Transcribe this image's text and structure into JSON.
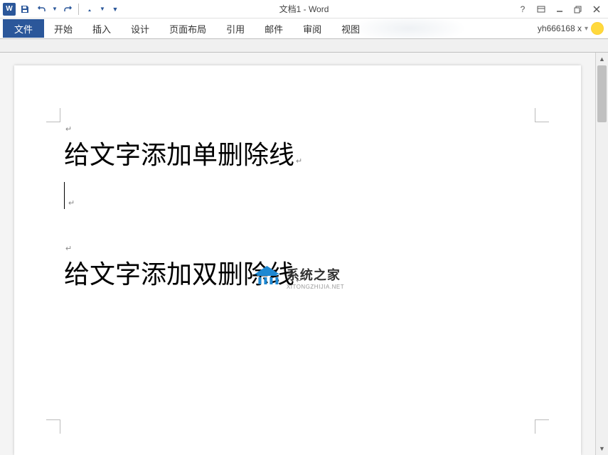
{
  "window": {
    "title": "文档1 - Word",
    "user": "yh666168 x"
  },
  "qat": {
    "save_tooltip": "保存",
    "undo_tooltip": "撤销",
    "redo_tooltip": "重做",
    "touch_tooltip": "触摸/鼠标模式"
  },
  "tabs": {
    "file": "文件",
    "home": "开始",
    "insert": "插入",
    "design": "设计",
    "layout": "页面布局",
    "references": "引用",
    "mailings": "邮件",
    "review": "审阅",
    "view": "视图"
  },
  "document": {
    "line1": "给文字添加单删除线",
    "line2": "给文字添加双删除线"
  },
  "watermark": {
    "cn": "系统之家",
    "en": "XITONGZHIJIA.NET"
  }
}
